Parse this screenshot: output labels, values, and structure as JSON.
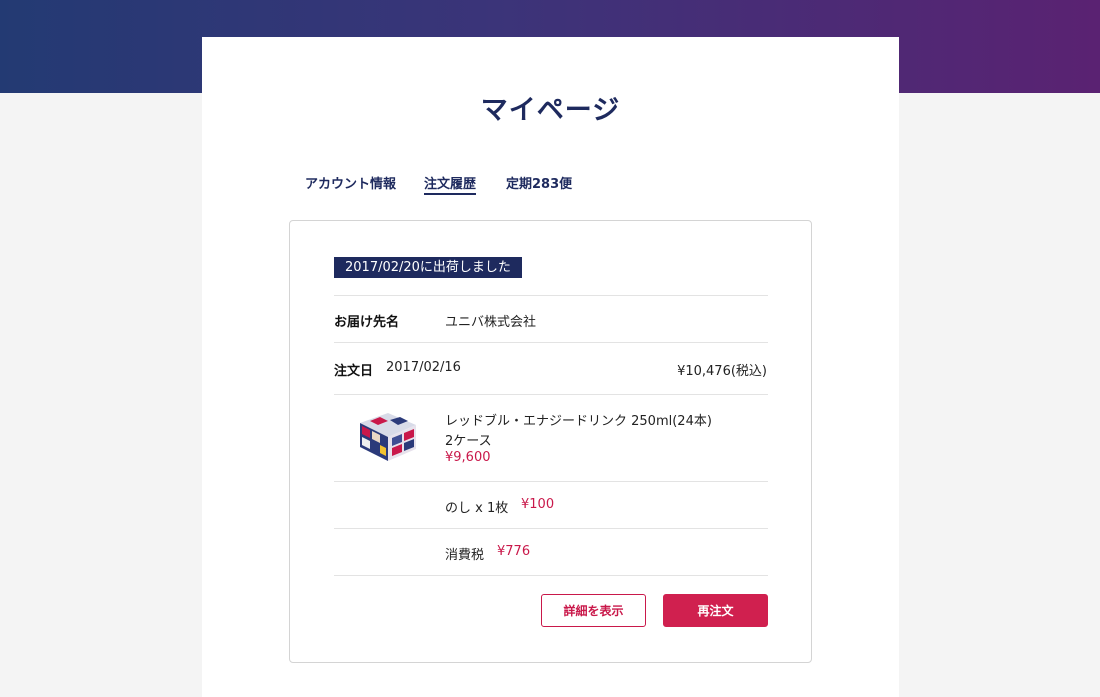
{
  "page": {
    "title": "マイページ"
  },
  "tabs": [
    {
      "label": "アカウント情報",
      "active": false
    },
    {
      "label": "注文履歴",
      "active": true
    },
    {
      "label": "定期283便",
      "active": false
    }
  ],
  "order": {
    "shipped_badge": "2017/02/20に出荷しました",
    "recipient_label": "お届け先名",
    "recipient_value": "ユニバ株式会社",
    "order_date_label": "注文日",
    "order_date_value": "2017/02/16",
    "total": "¥10,476(税込)",
    "item": {
      "image_icon": "product-box-image",
      "name": "レッドブル・エナジードリンク 250ml(24本)",
      "quantity": "2ケース",
      "price": "¥9,600"
    },
    "noshi": {
      "label": "のし x 1枚",
      "price": "¥100"
    },
    "tax": {
      "label": "消費税",
      "price": "¥776"
    }
  },
  "buttons": {
    "details": "詳細を表示",
    "reorder": "再注文"
  },
  "colors": {
    "navy": "#1e2a5e",
    "accent": "#d0204f",
    "price": "#c9184a",
    "band_start": "#233a73",
    "band_end": "#5a2272"
  }
}
